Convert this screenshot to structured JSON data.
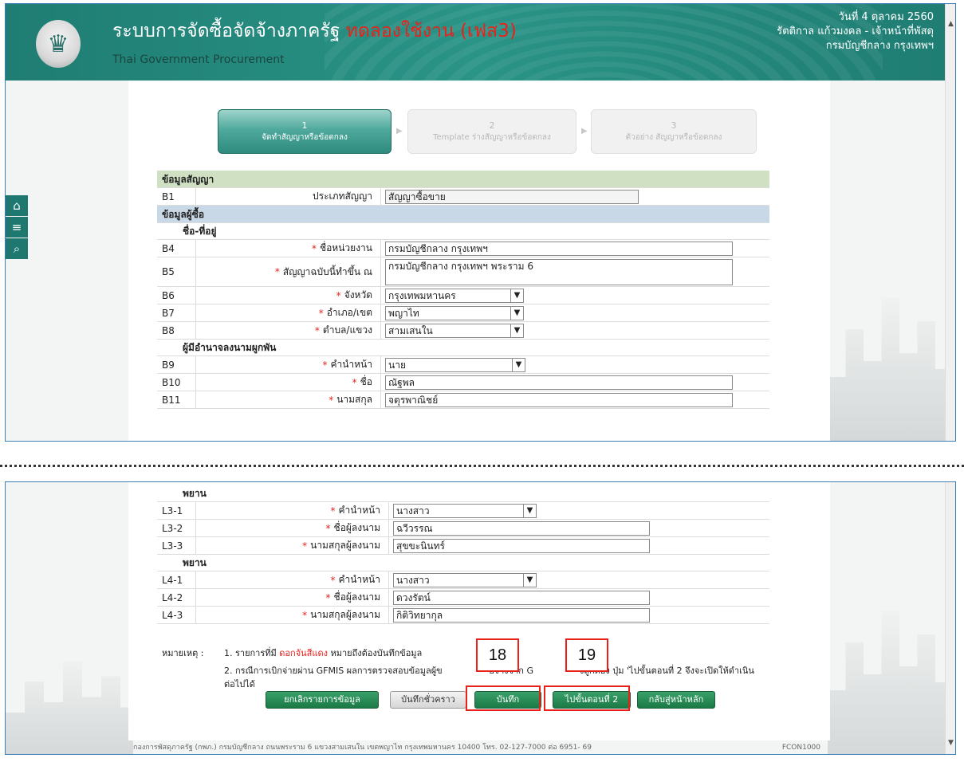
{
  "header": {
    "title": "ระบบการจัดซื้อจัดจ้างภาครัฐ",
    "trial_label": "ทดลองใช้งาน (เฟส3)",
    "subtitle": "Thai Government Procurement",
    "date": "วันที่ 4 ตุลาคม 2560",
    "user": "รัตติกาล แก้วมงคล - เจ้าหน้าที่พัสดุ",
    "department": "กรมบัญชีกลาง กรุงเทพฯ",
    "logo_text": "กรมบัญชีกลาง"
  },
  "colors": {
    "header_bg": "#2a9487",
    "required": "#e8221b",
    "button_green": "#1b7a46",
    "callout": "#e8221b"
  },
  "sidebar": {
    "icons": [
      "home-icon",
      "menu-icon",
      "search-icon"
    ]
  },
  "steps": [
    {
      "num": "1",
      "label": "จัดทำสัญญาหรือข้อตกลง"
    },
    {
      "num": "2",
      "label": "Template ร่างสัญญาหรือข้อตกลง"
    },
    {
      "num": "3",
      "label": "ตัวอย่าง สัญญาหรือข้อตกลง"
    }
  ],
  "top_form": {
    "contract_section": "ข้อมูลสัญญา",
    "b1": {
      "code": "B1",
      "label": "ประเภทสัญญา",
      "value": "สัญญาซื้อขาย"
    },
    "buyer_section": "ข้อมูลผู้ซื้อ",
    "address_sub": "ชื่อ-ที่อยู่",
    "b4": {
      "code": "B4",
      "label": "ชื่อหน่วยงาน",
      "value": "กรมบัญชีกลาง กรุงเทพฯ"
    },
    "b5": {
      "code": "B5",
      "label": "สัญญาฉบับนี้ทำขึ้น ณ",
      "value": "กรมบัญชีกลาง กรุงเทพฯ พระราม 6"
    },
    "b6": {
      "code": "B6",
      "label": "จังหวัด",
      "value": "กรุงเทพมหานคร"
    },
    "b7": {
      "code": "B7",
      "label": "อำเภอ/เขต",
      "value": "พญาไท"
    },
    "b8": {
      "code": "B8",
      "label": "ตำบล/แขวง",
      "value": "สามเสนใน"
    },
    "signer_sub": "ผู้มีอำนาจลงนามผูกพัน",
    "b9": {
      "code": "B9",
      "label": "คำนำหน้า",
      "value": "นาย"
    },
    "b10": {
      "code": "B10",
      "label": "ชื่อ",
      "value": "ณัฐพล"
    },
    "b11": {
      "code": "B11",
      "label": "นามสกุล",
      "value": "จตุรพาณิชย์"
    }
  },
  "bottom_form": {
    "witness_label": "พยาน",
    "l3_1": {
      "code": "L3-1",
      "label": "คำนำหน้า",
      "value": "นางสาว"
    },
    "l3_2": {
      "code": "L3-2",
      "label": "ชื่อผู้ลงนาม",
      "value": "ฉวีวรรณ"
    },
    "l3_3": {
      "code": "L3-3",
      "label": "นามสกุลผู้ลงนาม",
      "value": "สุขขะนินทร์"
    },
    "l4_1": {
      "code": "L4-1",
      "label": "คำนำหน้า",
      "value": "นางสาว"
    },
    "l4_2": {
      "code": "L4-2",
      "label": "ชื่อผู้ลงนาม",
      "value": "ดวงรัตน์"
    },
    "l4_3": {
      "code": "L4-3",
      "label": "นามสกุลผู้ลงนาม",
      "value": "กิติวิทยากุล"
    }
  },
  "notes": {
    "label": "หมายเหตุ :",
    "n1_prefix": "1. รายการที่มี",
    "n1_red": "ดอกจันสีแดง",
    "n1_suffix": "หมายถึงต้องบันทึกข้อมูล",
    "n2_part1": "2. กรณีการเบิกจ่ายผ่าน GFMIS ผลการตรวจสอบข้อมูลผู้ข",
    "n2_part2": "บจ้างจาก G",
    "n2_part3": "งถูกต้อง ปุ่ม 'ไปขั้นตอนที่ 2 จึงจะเปิดให้ดำเนิน",
    "n2_part4": "ต่อไปได้"
  },
  "buttons": {
    "cancel": "ยกเลิกรายการข้อมูล",
    "draft": "บันทึกชั่วคราว",
    "save": "บันทึก",
    "next": "ไปขั้นตอนที่ 2",
    "home": "กลับสู่หน้าหลัก"
  },
  "callouts": {
    "save_num": "18",
    "next_num": "19"
  },
  "footer": {
    "address": "กองการพัสดุภาครัฐ (กพภ.) กรมบัญชีกลาง ถนนพระราม 6 แขวงสามเสนใน เขตพญาไท กรุงเทพมหานคร 10400 โทร. 02-127-7000 ต่อ 6951- 69",
    "code": "FCON1000"
  }
}
